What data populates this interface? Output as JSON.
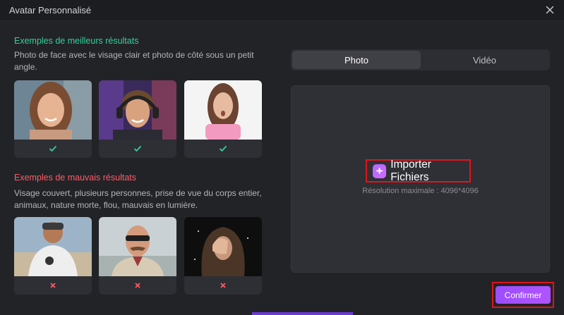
{
  "window": {
    "title": "Avatar Personnalisé",
    "close_icon": "close-icon"
  },
  "good_examples": {
    "title": "Exemples de meilleurs résultats",
    "description": "Photo de face avec le visage clair et photo de côté sous un petit angle.",
    "status_icon": "checkmark-icon",
    "color": "#33d29a"
  },
  "bad_examples": {
    "title": "Exemples de mauvais résultats",
    "description": "Visage couvert, plusieurs personnes, prise de vue du corps entier, animaux, nature morte, flou, mauvais en lumière.",
    "status_icon": "cross-icon",
    "color": "#ff5b64"
  },
  "tabs": [
    {
      "label": "Photo",
      "selected": true
    },
    {
      "label": "Vidéo",
      "selected": false
    }
  ],
  "upload": {
    "button_label": "Importer Fichiers",
    "plus_icon": "plus-icon",
    "resolution_note": "Résolution maximale : 4096*4096"
  },
  "footer": {
    "confirm_label": "Confirmer"
  },
  "colors": {
    "accent": "#a451ff",
    "highlight_border": "#e0141c",
    "background": "#222327"
  }
}
